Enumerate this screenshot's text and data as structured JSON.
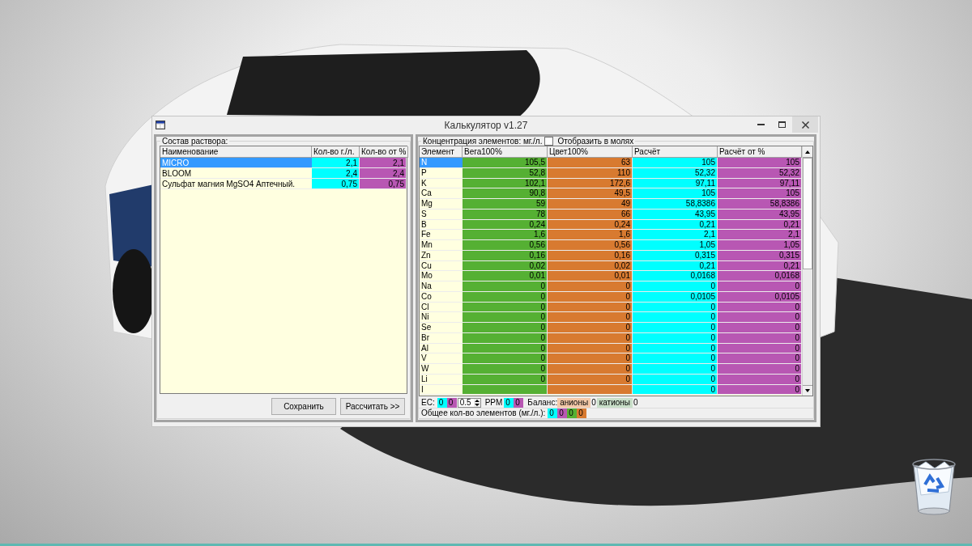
{
  "window": {
    "title": "Калькулятор v1.27"
  },
  "composition": {
    "title": "Состав раствора:",
    "columns": [
      {
        "label": "Наименование"
      },
      {
        "label": "Кол-во г./л.",
        "color": "#00ffff"
      },
      {
        "label": "Кол-во от %",
        "color": "#b857b3"
      }
    ],
    "rows": [
      {
        "name": "MICRO",
        "grams": "2,1",
        "percent": "2,1",
        "selected": true
      },
      {
        "name": "BLOOM",
        "grams": "2,4",
        "percent": "2,4",
        "selected": false
      },
      {
        "name": "Сульфат магния MgSO4 Аптечный.",
        "grams": "0,75",
        "percent": "0,75",
        "selected": false
      }
    ],
    "buttons": [
      "Сохранить",
      "Рассчитать >>"
    ]
  },
  "elements": {
    "title": "Концентрация элементов: мг./л.",
    "moles_checkbox": {
      "label": "Отобразить в молях",
      "checked": false
    },
    "columns": [
      {
        "label": "Элемент"
      },
      {
        "label": "Вега100%",
        "color": "#55b033"
      },
      {
        "label": "Цвет100%",
        "color": "#d87a30"
      },
      {
        "label": "Расчёт",
        "color": "#00ffff"
      },
      {
        "label": "Расчёт от %",
        "color": "#b857b3"
      }
    ],
    "rows": [
      {
        "element": "N",
        "vega_100": "105,5",
        "tsvet_100": "63",
        "calc": "105",
        "calc_percent": "105",
        "selected": true
      },
      {
        "element": "P",
        "vega_100": "52,8",
        "tsvet_100": "110",
        "calc": "52,32",
        "calc_percent": "52,32",
        "selected": false
      },
      {
        "element": "K",
        "vega_100": "102,1",
        "tsvet_100": "172,6",
        "calc": "97,11",
        "calc_percent": "97,11",
        "selected": false
      },
      {
        "element": "Ca",
        "vega_100": "90,8",
        "tsvet_100": "49,5",
        "calc": "105",
        "calc_percent": "105",
        "selected": false
      },
      {
        "element": "Mg",
        "vega_100": "59",
        "tsvet_100": "49",
        "calc": "58,8386",
        "calc_percent": "58,8386",
        "selected": false
      },
      {
        "element": "S",
        "vega_100": "78",
        "tsvet_100": "66",
        "calc": "43,95",
        "calc_percent": "43,95",
        "selected": false
      },
      {
        "element": "B",
        "vega_100": "0,24",
        "tsvet_100": "0,24",
        "calc": "0,21",
        "calc_percent": "0,21",
        "selected": false
      },
      {
        "element": "Fe",
        "vega_100": "1,6",
        "tsvet_100": "1,6",
        "calc": "2,1",
        "calc_percent": "2,1",
        "selected": false
      },
      {
        "element": "Mn",
        "vega_100": "0,56",
        "tsvet_100": "0,56",
        "calc": "1,05",
        "calc_percent": "1,05",
        "selected": false
      },
      {
        "element": "Zn",
        "vega_100": "0,16",
        "tsvet_100": "0,16",
        "calc": "0,315",
        "calc_percent": "0,315",
        "selected": false
      },
      {
        "element": "Cu",
        "vega_100": "0,02",
        "tsvet_100": "0,02",
        "calc": "0,21",
        "calc_percent": "0,21",
        "selected": false
      },
      {
        "element": "Mo",
        "vega_100": "0,01",
        "tsvet_100": "0,01",
        "calc": "0,0168",
        "calc_percent": "0,0168",
        "selected": false
      },
      {
        "element": "Na",
        "vega_100": "0",
        "tsvet_100": "0",
        "calc": "0",
        "calc_percent": "0",
        "selected": false
      },
      {
        "element": "Co",
        "vega_100": "0",
        "tsvet_100": "0",
        "calc": "0,0105",
        "calc_percent": "0,0105",
        "selected": false
      },
      {
        "element": "Cl",
        "vega_100": "0",
        "tsvet_100": "0",
        "calc": "0",
        "calc_percent": "0",
        "selected": false
      },
      {
        "element": "Ni",
        "vega_100": "0",
        "tsvet_100": "0",
        "calc": "0",
        "calc_percent": "0",
        "selected": false
      },
      {
        "element": "Se",
        "vega_100": "0",
        "tsvet_100": "0",
        "calc": "0",
        "calc_percent": "0",
        "selected": false
      },
      {
        "element": "Br",
        "vega_100": "0",
        "tsvet_100": "0",
        "calc": "0",
        "calc_percent": "0",
        "selected": false
      },
      {
        "element": "Al",
        "vega_100": "0",
        "tsvet_100": "0",
        "calc": "0",
        "calc_percent": "0",
        "selected": false
      },
      {
        "element": "V",
        "vega_100": "0",
        "tsvet_100": "0",
        "calc": "0",
        "calc_percent": "0",
        "selected": false
      },
      {
        "element": "W",
        "vega_100": "0",
        "tsvet_100": "0",
        "calc": "0",
        "calc_percent": "0",
        "selected": false
      },
      {
        "element": "Li",
        "vega_100": "0",
        "tsvet_100": "0",
        "calc": "0",
        "calc_percent": "0",
        "selected": false
      },
      {
        "element": "I",
        "calc": "0",
        "calc_percent": "0",
        "selected": false
      }
    ]
  },
  "status": {
    "ec": {
      "label": "EC:",
      "values": [
        {
          "text": "0",
          "color": "#00ffff"
        },
        {
          "text": "0",
          "color": "#b857b3"
        }
      ],
      "spinner": "0.5"
    },
    "ppm": {
      "label": "PPM",
      "values": [
        {
          "text": "0",
          "color": "#00ffff"
        },
        {
          "text": "0",
          "color": "#b857b3"
        }
      ]
    },
    "balance": {
      "label": "Баланс:",
      "items": [
        {
          "label": "анионы",
          "value": "0",
          "color": "#f4c9a9"
        },
        {
          "label": "катионы",
          "value": "0",
          "color": "#c9dfc9"
        }
      ]
    },
    "total": {
      "label": "Общее кол-во элементов (мг./л.):",
      "values": [
        {
          "text": "0",
          "color": "#00ffff"
        },
        {
          "text": "0",
          "color": "#b857b3"
        },
        {
          "text": "0",
          "color": "#55b033"
        },
        {
          "text": "0",
          "color": "#d87a30"
        }
      ]
    }
  }
}
